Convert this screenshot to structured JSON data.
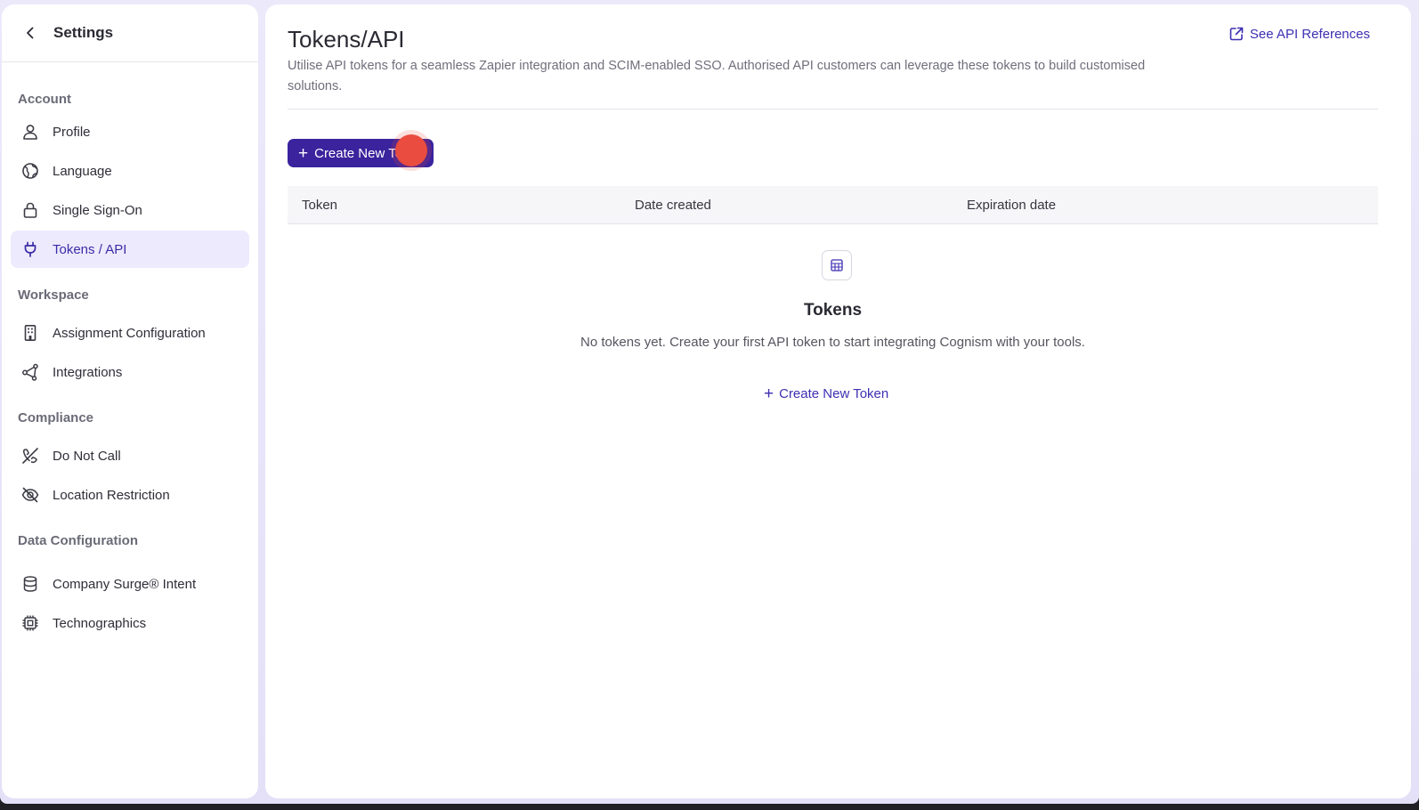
{
  "sidebar": {
    "title": "Settings",
    "groups": [
      {
        "label": "Account",
        "items": [
          {
            "label": "Profile",
            "icon": "user-icon"
          },
          {
            "label": "Language",
            "icon": "globe-icon"
          },
          {
            "label": "Single Sign-On",
            "icon": "lock-icon"
          },
          {
            "label": "Tokens / API",
            "icon": "plug-icon",
            "active": true
          }
        ]
      },
      {
        "label": "Workspace",
        "items": [
          {
            "label": "Assignment Configuration",
            "icon": "building-icon"
          },
          {
            "label": "Integrations",
            "icon": "share-nodes-icon"
          }
        ]
      },
      {
        "label": "Compliance",
        "items": [
          {
            "label": "Do Not Call",
            "icon": "phone-off-icon"
          },
          {
            "label": "Location Restriction",
            "icon": "eye-off-icon"
          }
        ]
      },
      {
        "label": "Data Configuration",
        "items": [
          {
            "label": "Company Surge® Intent",
            "icon": "database-icon"
          },
          {
            "label": "Technographics",
            "icon": "cpu-icon"
          }
        ]
      }
    ]
  },
  "main": {
    "title": "Tokens/API",
    "description": "Utilise API tokens for a seamless Zapier integration and SCIM-enabled SSO. Authorised API customers can leverage these tokens to build customised solutions.",
    "api_link": "See API References",
    "create_button": "Create New To",
    "table": {
      "columns": [
        "Token",
        "Date created",
        "Expiration date"
      ]
    },
    "empty_state": {
      "title": "Tokens",
      "text": "No tokens yet. Create your first API token to start integrating Cognism with your tools.",
      "link": "Create New Token"
    }
  },
  "colors": {
    "accent": "#3a239d",
    "link": "#3d2fb2",
    "active_bg": "#eeeafd",
    "click_marker": "#ea4c3f"
  }
}
